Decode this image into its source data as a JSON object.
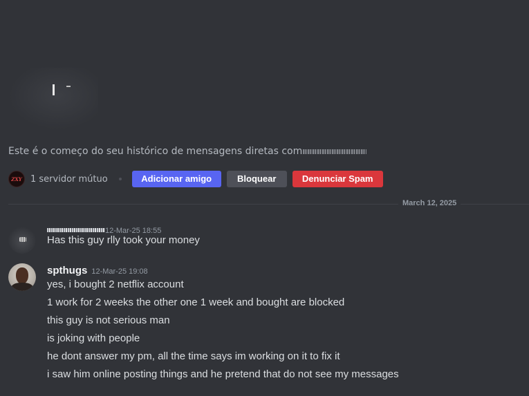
{
  "intro": {
    "text": "Este é o começo do seu histórico de mensagens diretas com"
  },
  "actions": {
    "mutual_servers": "1 servidor mútuo",
    "add_friend": "Adicionar amigo",
    "block": "Bloquear",
    "report_spam": "Denunciar Spam"
  },
  "divider": {
    "date": "March 12, 2025"
  },
  "messages": [
    {
      "author": "",
      "timestamp": "12-Mar-25 18:55",
      "lines": [
        "Has this guy rlly took your money"
      ]
    },
    {
      "author": "spthugs",
      "timestamp": "12-Mar-25 19:08",
      "lines": [
        "yes, i bought 2 netflix account",
        "1 work for 2 weeks the other one 1 week and bought are blocked",
        "this guy is not serious man",
        "is joking with people",
        "he dont answer my pm, all the time says im working on it to fix it",
        "i saw him online posting things and he pretend that do not see my messages"
      ]
    }
  ],
  "colors": {
    "background": "#313338",
    "add_friend": "#5865f2",
    "block": "#4e5058",
    "report_spam": "#da373c"
  }
}
